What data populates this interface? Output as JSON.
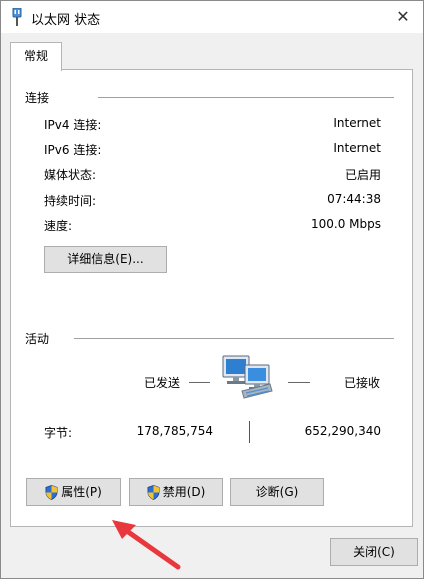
{
  "window": {
    "title": "以太网 状态",
    "close_symbol": "✕"
  },
  "tabs": [
    {
      "label": "常规"
    }
  ],
  "connection": {
    "heading": "连接",
    "rows": [
      {
        "label": "IPv4 连接:",
        "value": "Internet"
      },
      {
        "label": "IPv6 连接:",
        "value": "Internet"
      },
      {
        "label": "媒体状态:",
        "value": "已启用"
      },
      {
        "label": "持续时间:",
        "value": "07:44:38"
      },
      {
        "label": "速度:",
        "value": "100.0 Mbps"
      }
    ],
    "details_button": "详细信息(E)..."
  },
  "activity": {
    "heading": "活动",
    "sent_label": "已发送",
    "received_label": "已接收",
    "bytes_label": "字节:",
    "bytes_sent": "178,785,754",
    "bytes_received": "652,290,340"
  },
  "buttons": {
    "properties": "属性(P)",
    "disable": "禁用(D)",
    "diagnose": "诊断(G)",
    "close": "关闭(C)"
  },
  "icons": {
    "title": "network-adapter-icon",
    "activity": "network-computers-icon",
    "shield": "uac-shield-icon",
    "annotation": "red-arrow"
  },
  "colors": {
    "annotation_arrow": "#e8383d",
    "shield_blue": "#2b6fd6",
    "shield_yellow": "#f2c230"
  }
}
